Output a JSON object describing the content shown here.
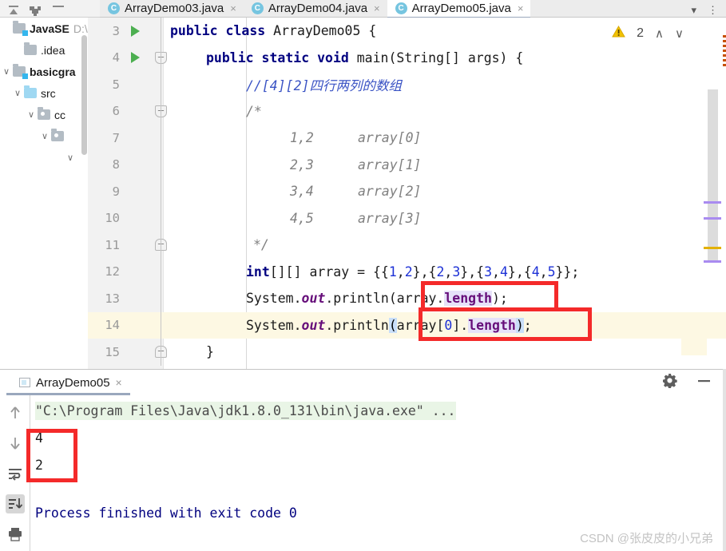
{
  "window": {
    "toolbar_icons": [
      "collapse-all-icon",
      "settings-gear-icon",
      "hide-icon"
    ]
  },
  "tabs": {
    "items": [
      {
        "label": "ArrayDemo03.java",
        "icon": "java-class-icon",
        "active": false,
        "close": "×"
      },
      {
        "label": "ArrayDemo04.java",
        "icon": "java-class-icon",
        "active": false,
        "close": "×"
      },
      {
        "label": "ArrayDemo05.java",
        "icon": "java-class-icon",
        "active": true,
        "close": "×"
      }
    ],
    "overflow_label": "▾",
    "more_label": "⋮"
  },
  "sidebar": {
    "items": [
      {
        "label": "JavaSE",
        "path": "D:\\",
        "bold": true,
        "indent": 0,
        "chevron": "",
        "folder": "module-folder-icon"
      },
      {
        "label": ".idea",
        "path": "",
        "bold": false,
        "indent": 1,
        "chevron": "",
        "folder": "plain-folder-icon"
      },
      {
        "label": "basicgra",
        "path": "",
        "bold": true,
        "indent": 1,
        "chevron": "∨",
        "folder": "module-folder-icon"
      },
      {
        "label": "src",
        "path": "",
        "bold": false,
        "indent": 2,
        "chevron": "∨",
        "folder": "source-folder-icon"
      },
      {
        "label": "cc",
        "path": "",
        "bold": false,
        "indent": 3,
        "chevron": "∨",
        "folder": "package-folder-icon"
      },
      {
        "label": "",
        "path": "",
        "bold": false,
        "indent": 4,
        "chevron": "∨",
        "folder": "package-folder-icon"
      },
      {
        "label": "",
        "path": "",
        "bold": false,
        "indent": 5,
        "chevron": "∨",
        "folder": ""
      }
    ]
  },
  "editor": {
    "warning_icon": "warning-triangle-icon",
    "warning_count": "2",
    "prev_label": "∧",
    "next_label": "∨",
    "lines": [
      {
        "num": "3",
        "run": true,
        "fold": "open",
        "highlight": false
      },
      {
        "num": "4",
        "run": true,
        "fold": "open",
        "highlight": false
      },
      {
        "num": "5",
        "run": false,
        "fold": "",
        "highlight": false
      },
      {
        "num": "6",
        "run": false,
        "fold": "open",
        "highlight": false
      },
      {
        "num": "7",
        "run": false,
        "fold": "",
        "highlight": false
      },
      {
        "num": "8",
        "run": false,
        "fold": "",
        "highlight": false
      },
      {
        "num": "9",
        "run": false,
        "fold": "",
        "highlight": false
      },
      {
        "num": "10",
        "run": false,
        "fold": "",
        "highlight": false
      },
      {
        "num": "11",
        "run": false,
        "fold": "close",
        "highlight": false
      },
      {
        "num": "12",
        "run": false,
        "fold": "",
        "highlight": false
      },
      {
        "num": "13",
        "run": false,
        "fold": "",
        "highlight": false
      },
      {
        "num": "14",
        "run": false,
        "fold": "",
        "highlight": true
      },
      {
        "num": "15",
        "run": false,
        "fold": "close",
        "highlight": false
      }
    ],
    "code": {
      "l3": "public class ArrayDemo05 {",
      "l4": "public static void main(String[] args) {",
      "l5": "//[4][2]四行两列的数组",
      "l6": "/*",
      "l7_a": "1,2",
      "l7_b": "array[0]",
      "l8_a": "2,3",
      "l8_b": "array[1]",
      "l9_a": "3,4",
      "l9_b": "array[2]",
      "l10_a": "4,5",
      "l10_b": "array[3]",
      "l11": "*/",
      "l12": "int[][] array = {{1,2},{2,3},{3,4},{4,5}};",
      "l13": "System.out.println(array.length);",
      "l14": "System.out.println(array[0].length);",
      "l15": "}"
    }
  },
  "console": {
    "tab_label": "ArrayDemo05",
    "tab_icon": "console-window-icon",
    "tab_close": "×",
    "settings_icon": "gear-icon",
    "minimize_icon": "minimize-icon",
    "side_icons": [
      {
        "name": "scroll-up-icon",
        "glyph": "↑",
        "active": false
      },
      {
        "name": "scroll-down-icon",
        "glyph": "↓",
        "active": false
      },
      {
        "name": "soft-wrap-icon",
        "glyph": "↵",
        "active": false
      },
      {
        "name": "scroll-to-end-icon",
        "glyph": "↓",
        "active": true
      },
      {
        "name": "print-icon",
        "glyph": "⎙",
        "active": false
      }
    ],
    "output": {
      "command": "\"C:\\Program Files\\Java\\jdk1.8.0_131\\bin\\java.exe\" ...",
      "result_1": "4",
      "result_2": "2",
      "finished": "Process finished with exit code 0"
    }
  },
  "annotations": {
    "watermark": "CSDN @张皮皮的小兄弟",
    "box_color": "#f42a2a",
    "boxes": [
      {
        "name": "redbox-array-length"
      },
      {
        "name": "redbox-array0-length"
      },
      {
        "name": "redbox-console-output"
      }
    ]
  }
}
